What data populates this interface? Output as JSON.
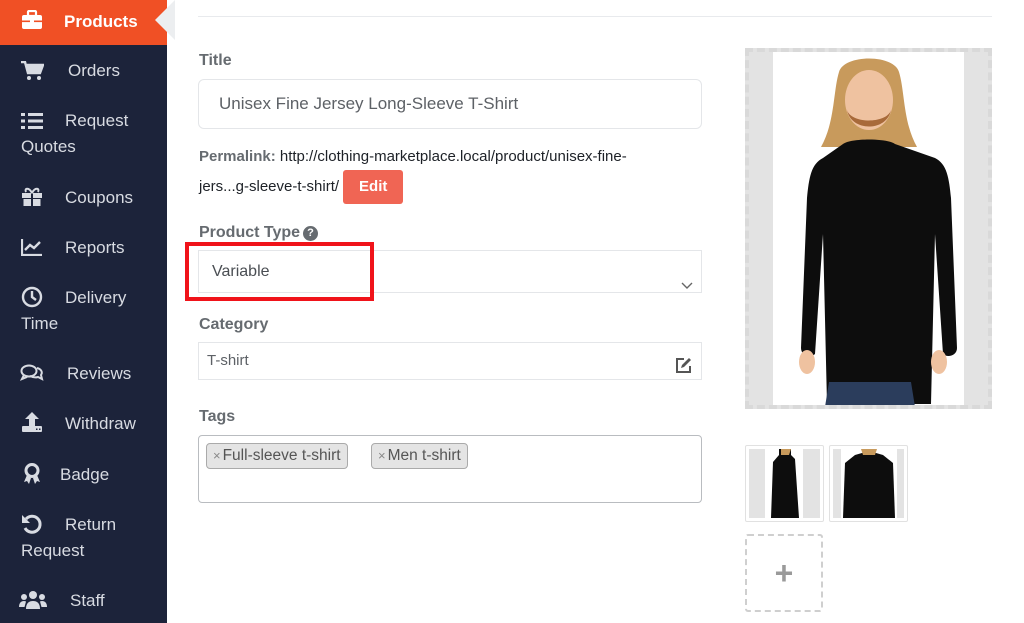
{
  "sidebar": {
    "items": [
      {
        "label": "Products",
        "icon": "briefcase-icon",
        "active": true
      },
      {
        "label": "Orders",
        "icon": "cart-icon"
      },
      {
        "label_line1": "Request",
        "label_line2": "Quotes",
        "icon": "list-icon"
      },
      {
        "label": "Coupons",
        "icon": "gift-icon"
      },
      {
        "label": "Reports",
        "icon": "chart-line-icon"
      },
      {
        "label_line1": "Delivery",
        "label_line2": "Time",
        "icon": "clock-icon"
      },
      {
        "label": "Reviews",
        "icon": "comments-icon"
      },
      {
        "label": "Withdraw",
        "icon": "upload-icon"
      },
      {
        "label": "Badge",
        "icon": "award-icon"
      },
      {
        "label_line1": "Return",
        "label_line2": "Request",
        "icon": "undo-icon"
      },
      {
        "label": "Staff",
        "icon": "users-icon"
      }
    ],
    "active_color": "#f05025",
    "bg_color": "#1c233a"
  },
  "form": {
    "title_label": "Title",
    "title_value": "Unisex Fine Jersey Long-Sleeve T-Shirt",
    "permalink_label": "Permalink:",
    "permalink_url_line1": "http://clothing-marketplace.local/product/unisex-fine-",
    "permalink_url_line2": "jers...g-sleeve-t-shirt/",
    "edit_button": "Edit",
    "product_type_label": "Product Type",
    "product_type_help": "?",
    "product_type_value": "Variable",
    "category_label": "Category",
    "category_value": "T-shirt",
    "tags_label": "Tags",
    "tags": [
      "Full-sleeve t-shirt",
      "Men t-shirt"
    ],
    "tag_remove": "×"
  },
  "gallery": {
    "main_image_alt": "Man wearing black long-sleeve t-shirt",
    "thumbnails": [
      "Side view black long-sleeve t-shirt",
      "Back view black long-sleeve t-shirt"
    ],
    "add_label": "+"
  }
}
